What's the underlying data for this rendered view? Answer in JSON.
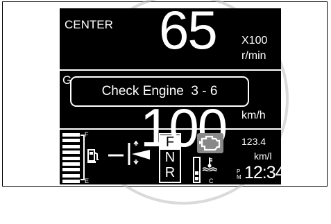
{
  "display": {
    "mode_label": "CENTER",
    "rpm_value": "65",
    "rpm_multiplier": "X100",
    "rpm_unit": "r/min",
    "speed_label_partial": "G",
    "speed_value_partial": "100",
    "speed_unit": "km/h",
    "alert_text": "Check Engine  3 - 6",
    "fuel_gauge": {
      "full_label": "F",
      "empty_label": "E",
      "level": 1.0
    },
    "gears": [
      "F",
      "N",
      "R"
    ],
    "selected_gear": "F",
    "temp_gauge": {
      "cold_label": "C"
    },
    "fuel_economy": {
      "value": "123.4",
      "unit": "km/l"
    },
    "clock": {
      "am": "P",
      "pm": "M",
      "time": "12:34"
    }
  },
  "colors": {
    "screen": "#000000",
    "foreground": "#ffffff",
    "warning_icon_bg": "#888888"
  }
}
